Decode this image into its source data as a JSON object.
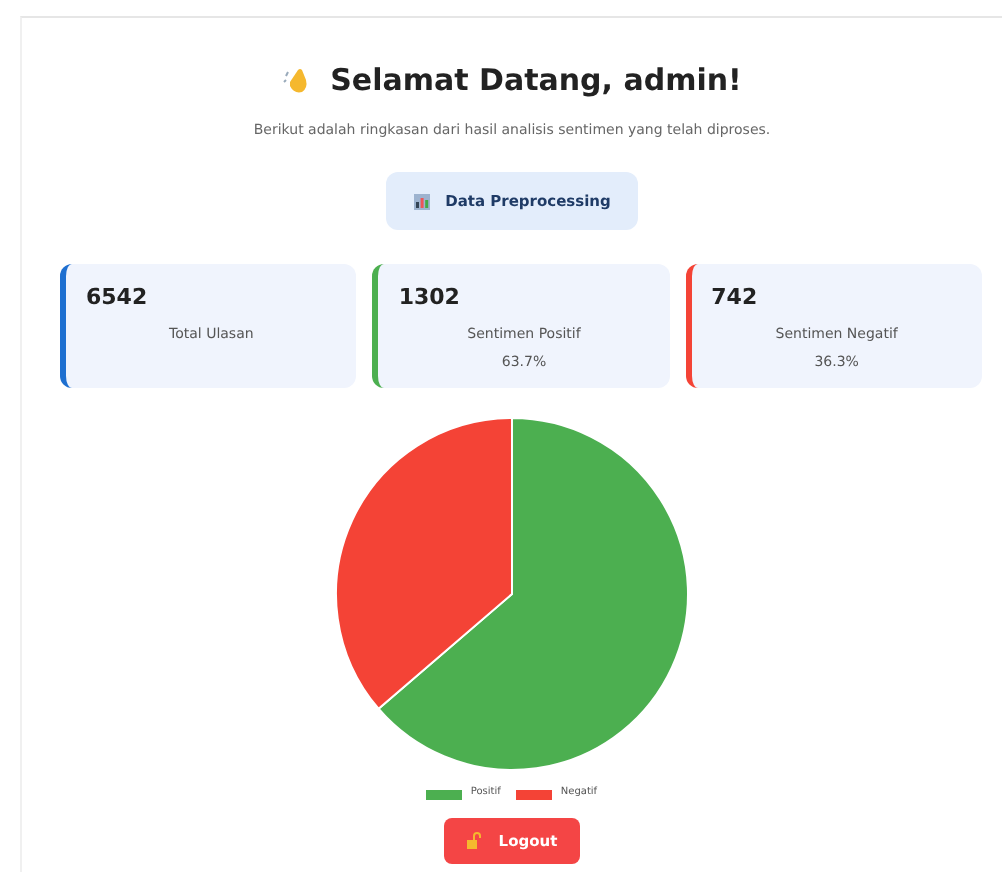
{
  "header": {
    "title": "Selamat Datang, admin!",
    "subtitle": "Berikut adalah ringkasan dari hasil analisis sentimen yang telah diproses."
  },
  "preprocessing_button": {
    "label": "Data Preprocessing"
  },
  "stats": [
    {
      "value": "6542",
      "label": "Total Ulasan",
      "color": "#1e6fd0"
    },
    {
      "value": "1302",
      "label": "Sentimen Positif",
      "percent": "63.7%",
      "color": "#4caf50"
    },
    {
      "value": "742",
      "label": "Sentimen Negatif",
      "percent": "36.3%",
      "color": "#f44336"
    }
  ],
  "chart": {
    "chart_data": {
      "type": "pie",
      "categories": [
        "Positif",
        "Negatif"
      ],
      "values": [
        63.7,
        36.3
      ],
      "colors": [
        "#4caf50",
        "#f44336"
      ]
    }
  },
  "logout_button": {
    "label": "Logout"
  }
}
